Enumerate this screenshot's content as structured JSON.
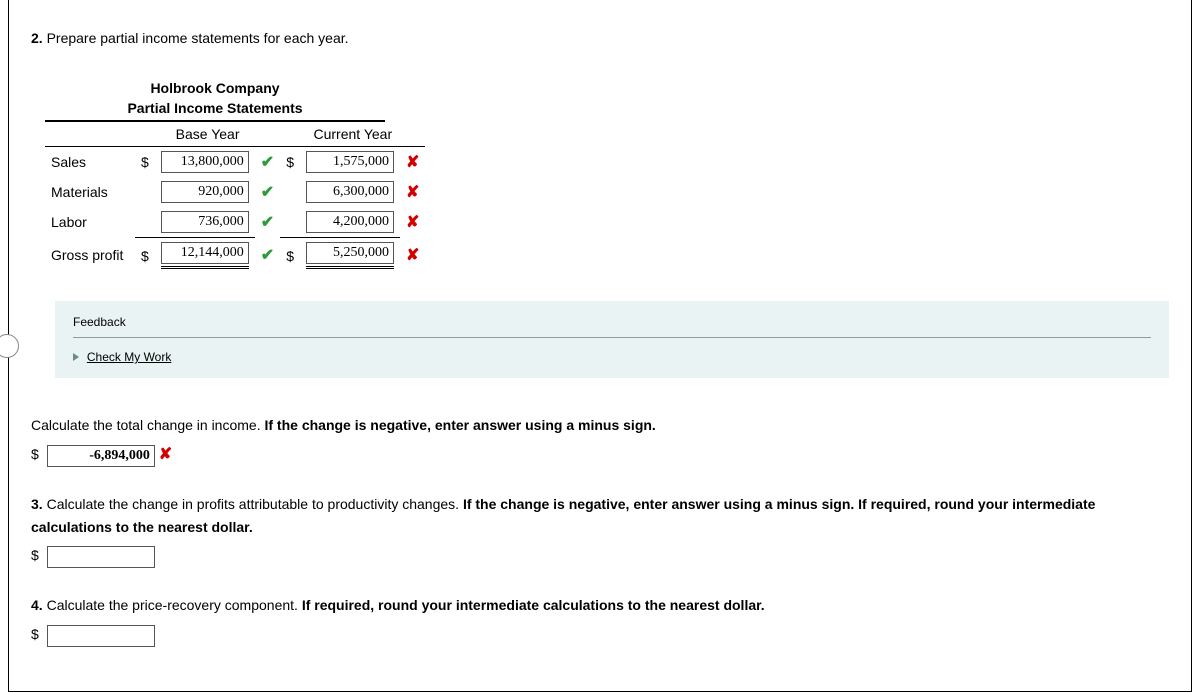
{
  "q2": {
    "num": "2.",
    "text": "Prepare partial income statements for each year."
  },
  "statement": {
    "company": "Holbrook Company",
    "title": "Partial Income Statements",
    "col1": "Base Year",
    "col2": "Current Year",
    "rows": {
      "sales": {
        "label": "Sales",
        "base": "13,800,000",
        "base_mark": "✔",
        "cur": "1,575,000",
        "cur_mark": "✘",
        "base_dollar": "$",
        "cur_dollar": "$"
      },
      "materials": {
        "label": "Materials",
        "base": "920,000",
        "base_mark": "✔",
        "cur": "6,300,000",
        "cur_mark": "✘",
        "base_dollar": "",
        "cur_dollar": ""
      },
      "labor": {
        "label": "Labor",
        "base": "736,000",
        "base_mark": "✔",
        "cur": "4,200,000",
        "cur_mark": "✘",
        "base_dollar": "",
        "cur_dollar": ""
      },
      "gross": {
        "label": "Gross profit",
        "base": "12,144,000",
        "base_mark": "✔",
        "cur": "5,250,000",
        "cur_mark": "✘",
        "base_dollar": "$",
        "cur_dollar": "$"
      }
    }
  },
  "feedback": {
    "title": "Feedback",
    "link": "Check My Work"
  },
  "calc_change": {
    "text_a": "Calculate the total change in income. ",
    "text_b": "If the change is negative, enter answer using a minus sign.",
    "value": "-6,894,000",
    "mark": "✘",
    "dollar": "$"
  },
  "q3": {
    "num": "3.",
    "text_a": " Calculate the change in profits attributable to productivity changes. ",
    "text_b": "If the change is negative, enter answer using a minus sign. If required, round your intermediate calculations to the nearest dollar.",
    "dollar": "$"
  },
  "q4": {
    "num": "4.",
    "text_a": " Calculate the price-recovery component. ",
    "text_b": "If required, round your intermediate calculations to the nearest dollar.",
    "dollar": "$"
  }
}
